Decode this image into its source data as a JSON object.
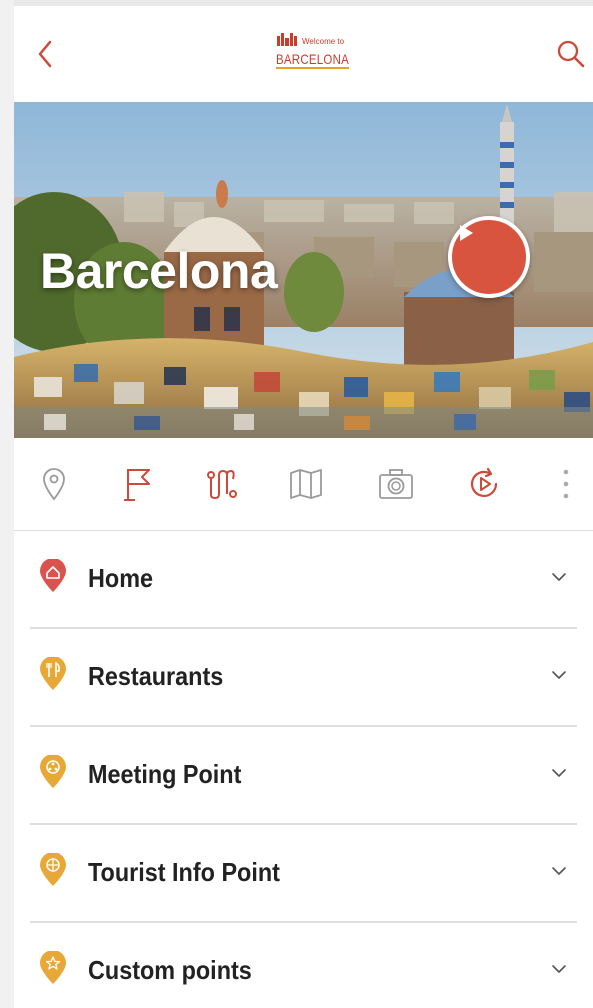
{
  "header": {
    "back_icon": "chevron-left-icon",
    "search_icon": "search-icon",
    "logo": {
      "welcome_text": "Welcome to",
      "city_text": "BARCELONA"
    }
  },
  "hero": {
    "title": "Barcelona",
    "play_icon": "play-icon"
  },
  "toolbar": {
    "icons": [
      "location-pin-icon",
      "flag-icon",
      "route-icon",
      "map-icon",
      "camera-icon",
      "replay-icon",
      "more-vertical-icon"
    ],
    "colors": {
      "inactive": "#9a9a9a",
      "active": "#cc4a3a"
    }
  },
  "list": {
    "items": [
      {
        "label": "Home",
        "icon": "home-pin-icon",
        "pin_color": "#d9534f"
      },
      {
        "label": "Restaurants",
        "icon": "restaurant-pin-icon",
        "pin_color": "#e8a838"
      },
      {
        "label": "Meeting Point",
        "icon": "meeting-pin-icon",
        "pin_color": "#e8a838"
      },
      {
        "label": "Tourist Info Point",
        "icon": "info-pin-icon",
        "pin_color": "#e8a838"
      },
      {
        "label": "Custom points",
        "icon": "star-pin-icon",
        "pin_color": "#e8a838"
      }
    ]
  },
  "colors": {
    "accent": "#cc4a3a",
    "gold": "#e8a838"
  }
}
